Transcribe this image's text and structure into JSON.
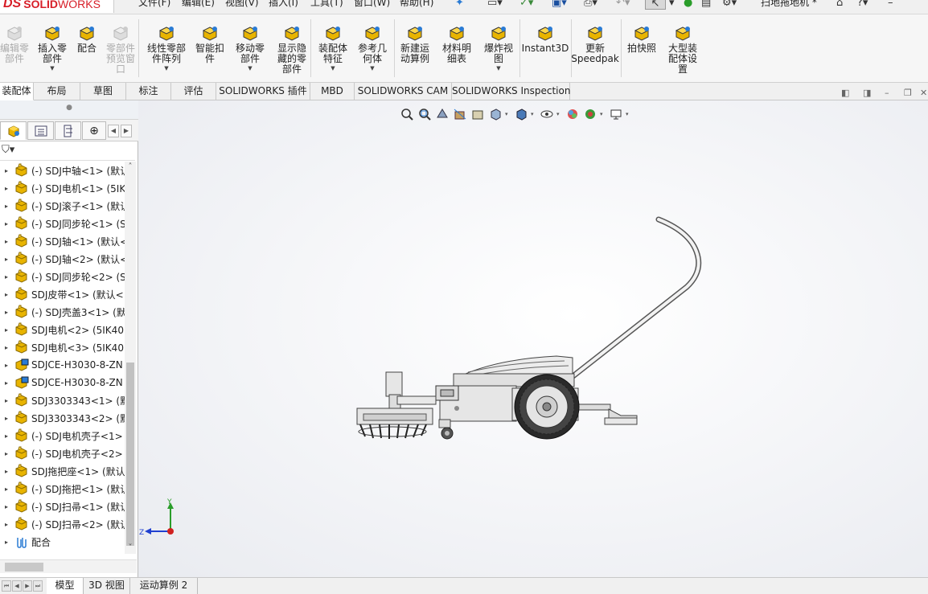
{
  "app": {
    "logo_ds": "DS",
    "logo_solid": "SOLID",
    "logo_works": "WORKS",
    "doc_title": "扫地拖地机 *"
  },
  "menu": [
    "文件(F)",
    "编辑(E)",
    "视图(V)",
    "插入(I)",
    "工具(T)",
    "窗口(W)",
    "帮助(H)"
  ],
  "commands": [
    {
      "label": "编辑零\n部件",
      "icon": "edit-component-icon",
      "disabled": true,
      "arrow": false
    },
    {
      "label": "插入零\n部件",
      "icon": "insert-component-icon",
      "disabled": false,
      "arrow": true
    },
    {
      "label": "配合",
      "icon": "mate-icon",
      "disabled": false,
      "arrow": false
    },
    {
      "label": "零部件\n预览窗\n口",
      "icon": "preview-window-icon",
      "disabled": true,
      "arrow": false
    },
    {
      "label": "线性零部\n件阵列",
      "icon": "linear-pattern-icon",
      "disabled": false,
      "arrow": true
    },
    {
      "label": "智能扣\n件",
      "icon": "smart-fasteners-icon",
      "disabled": false,
      "arrow": false
    },
    {
      "label": "移动零\n部件",
      "icon": "move-component-icon",
      "disabled": false,
      "arrow": true
    },
    {
      "label": "显示隐\n藏的零\n部件",
      "icon": "show-hidden-icon",
      "disabled": false,
      "arrow": false
    },
    {
      "label": "装配体\n特征",
      "icon": "assembly-features-icon",
      "disabled": false,
      "arrow": true
    },
    {
      "label": "参考几\n何体",
      "icon": "reference-geometry-icon",
      "disabled": false,
      "arrow": true
    },
    {
      "label": "新建运\n动算例",
      "icon": "new-motion-study-icon",
      "disabled": false,
      "arrow": false
    },
    {
      "label": "材料明\n细表",
      "icon": "bill-of-materials-icon",
      "disabled": false,
      "arrow": false
    },
    {
      "label": "爆炸视\n图",
      "icon": "exploded-view-icon",
      "disabled": false,
      "arrow": true
    },
    {
      "label": "Instant3D",
      "icon": "instant3d-icon",
      "disabled": false,
      "arrow": false
    },
    {
      "label": "更新\nSpeedpak",
      "icon": "speedpak-icon",
      "disabled": false,
      "arrow": false
    },
    {
      "label": "拍快照",
      "icon": "snapshot-icon",
      "disabled": false,
      "arrow": false
    },
    {
      "label": "大型装\n配体设\n置",
      "icon": "large-assembly-icon",
      "disabled": false,
      "arrow": false
    }
  ],
  "tabs": [
    "装配体",
    "布局",
    "草图",
    "标注",
    "评估",
    "SOLIDWORKS 插件",
    "MBD",
    "SOLIDWORKS CAM",
    "SOLIDWORKS Inspection"
  ],
  "tree": [
    {
      "label": "(-) SDJ中轴<1> (默认",
      "icon": "part-icon"
    },
    {
      "label": "(-) SDJ电机<1> (5IK",
      "icon": "part-icon"
    },
    {
      "label": "(-) SDJ滚子<1> (默认",
      "icon": "part-icon"
    },
    {
      "label": "(-) SDJ同步轮<1> (S",
      "icon": "part-icon"
    },
    {
      "label": "(-) SDJ轴<1> (默认<",
      "icon": "part-icon"
    },
    {
      "label": "(-) SDJ轴<2> (默认<",
      "icon": "part-icon"
    },
    {
      "label": "(-) SDJ同步轮<2> (S",
      "icon": "part-icon"
    },
    {
      "label": "SDJ皮带<1> (默认<<",
      "icon": "part-icon"
    },
    {
      "label": "(-) SDJ壳盖3<1> (默",
      "icon": "part-icon"
    },
    {
      "label": "SDJ电机<2> (5IK40",
      "icon": "part-icon"
    },
    {
      "label": "SDJ电机<3> (5IK40",
      "icon": "part-icon"
    },
    {
      "label": "SDJCE-H3030-8-ZN",
      "icon": "toolbox-part-icon"
    },
    {
      "label": "SDJCE-H3030-8-ZN",
      "icon": "toolbox-part-icon"
    },
    {
      "label": "SDJ3303343<1> (默",
      "icon": "part-icon"
    },
    {
      "label": "SDJ3303343<2> (默",
      "icon": "part-icon"
    },
    {
      "label": "(-) SDJ电机壳子<1>",
      "icon": "part-icon"
    },
    {
      "label": "(-) SDJ电机壳子<2>",
      "icon": "part-icon"
    },
    {
      "label": "SDJ拖把座<1> (默认",
      "icon": "part-icon"
    },
    {
      "label": "(-) SDJ拖把<1> (默认",
      "icon": "part-icon"
    },
    {
      "label": "(-) SDJ扫帚<1> (默认",
      "icon": "part-icon"
    },
    {
      "label": "(-) SDJ扫帚<2> (默认",
      "icon": "part-icon"
    },
    {
      "label": "配合",
      "icon": "mates-folder-icon"
    }
  ],
  "triad": {
    "y": "Y",
    "z": "Z"
  },
  "bottom_tabs": [
    "模型",
    "3D 视图",
    "运动算例 2"
  ],
  "colors": {
    "accent": "#d71e28",
    "part_yellow": "#e8b400",
    "triad_green": "#2a9d2a",
    "triad_blue": "#2040d0",
    "triad_red": "#d02020"
  }
}
